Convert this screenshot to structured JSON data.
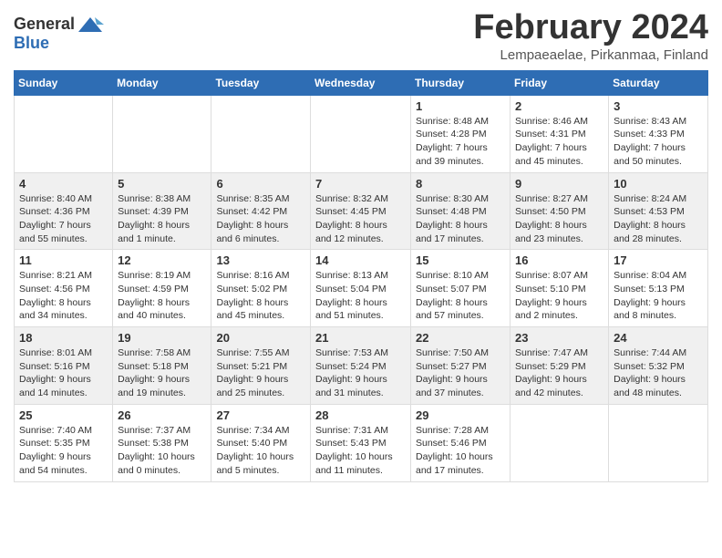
{
  "header": {
    "logo_general": "General",
    "logo_blue": "Blue",
    "month_title": "February 2024",
    "subtitle": "Lempaeaelae, Pirkanmaa, Finland"
  },
  "weekdays": [
    "Sunday",
    "Monday",
    "Tuesday",
    "Wednesday",
    "Thursday",
    "Friday",
    "Saturday"
  ],
  "weeks": [
    [
      {
        "day": "",
        "info": ""
      },
      {
        "day": "",
        "info": ""
      },
      {
        "day": "",
        "info": ""
      },
      {
        "day": "",
        "info": ""
      },
      {
        "day": "1",
        "info": "Sunrise: 8:48 AM\nSunset: 4:28 PM\nDaylight: 7 hours\nand 39 minutes."
      },
      {
        "day": "2",
        "info": "Sunrise: 8:46 AM\nSunset: 4:31 PM\nDaylight: 7 hours\nand 45 minutes."
      },
      {
        "day": "3",
        "info": "Sunrise: 8:43 AM\nSunset: 4:33 PM\nDaylight: 7 hours\nand 50 minutes."
      }
    ],
    [
      {
        "day": "4",
        "info": "Sunrise: 8:40 AM\nSunset: 4:36 PM\nDaylight: 7 hours\nand 55 minutes."
      },
      {
        "day": "5",
        "info": "Sunrise: 8:38 AM\nSunset: 4:39 PM\nDaylight: 8 hours\nand 1 minute."
      },
      {
        "day": "6",
        "info": "Sunrise: 8:35 AM\nSunset: 4:42 PM\nDaylight: 8 hours\nand 6 minutes."
      },
      {
        "day": "7",
        "info": "Sunrise: 8:32 AM\nSunset: 4:45 PM\nDaylight: 8 hours\nand 12 minutes."
      },
      {
        "day": "8",
        "info": "Sunrise: 8:30 AM\nSunset: 4:48 PM\nDaylight: 8 hours\nand 17 minutes."
      },
      {
        "day": "9",
        "info": "Sunrise: 8:27 AM\nSunset: 4:50 PM\nDaylight: 8 hours\nand 23 minutes."
      },
      {
        "day": "10",
        "info": "Sunrise: 8:24 AM\nSunset: 4:53 PM\nDaylight: 8 hours\nand 28 minutes."
      }
    ],
    [
      {
        "day": "11",
        "info": "Sunrise: 8:21 AM\nSunset: 4:56 PM\nDaylight: 8 hours\nand 34 minutes."
      },
      {
        "day": "12",
        "info": "Sunrise: 8:19 AM\nSunset: 4:59 PM\nDaylight: 8 hours\nand 40 minutes."
      },
      {
        "day": "13",
        "info": "Sunrise: 8:16 AM\nSunset: 5:02 PM\nDaylight: 8 hours\nand 45 minutes."
      },
      {
        "day": "14",
        "info": "Sunrise: 8:13 AM\nSunset: 5:04 PM\nDaylight: 8 hours\nand 51 minutes."
      },
      {
        "day": "15",
        "info": "Sunrise: 8:10 AM\nSunset: 5:07 PM\nDaylight: 8 hours\nand 57 minutes."
      },
      {
        "day": "16",
        "info": "Sunrise: 8:07 AM\nSunset: 5:10 PM\nDaylight: 9 hours\nand 2 minutes."
      },
      {
        "day": "17",
        "info": "Sunrise: 8:04 AM\nSunset: 5:13 PM\nDaylight: 9 hours\nand 8 minutes."
      }
    ],
    [
      {
        "day": "18",
        "info": "Sunrise: 8:01 AM\nSunset: 5:16 PM\nDaylight: 9 hours\nand 14 minutes."
      },
      {
        "day": "19",
        "info": "Sunrise: 7:58 AM\nSunset: 5:18 PM\nDaylight: 9 hours\nand 19 minutes."
      },
      {
        "day": "20",
        "info": "Sunrise: 7:55 AM\nSunset: 5:21 PM\nDaylight: 9 hours\nand 25 minutes."
      },
      {
        "day": "21",
        "info": "Sunrise: 7:53 AM\nSunset: 5:24 PM\nDaylight: 9 hours\nand 31 minutes."
      },
      {
        "day": "22",
        "info": "Sunrise: 7:50 AM\nSunset: 5:27 PM\nDaylight: 9 hours\nand 37 minutes."
      },
      {
        "day": "23",
        "info": "Sunrise: 7:47 AM\nSunset: 5:29 PM\nDaylight: 9 hours\nand 42 minutes."
      },
      {
        "day": "24",
        "info": "Sunrise: 7:44 AM\nSunset: 5:32 PM\nDaylight: 9 hours\nand 48 minutes."
      }
    ],
    [
      {
        "day": "25",
        "info": "Sunrise: 7:40 AM\nSunset: 5:35 PM\nDaylight: 9 hours\nand 54 minutes."
      },
      {
        "day": "26",
        "info": "Sunrise: 7:37 AM\nSunset: 5:38 PM\nDaylight: 10 hours\nand 0 minutes."
      },
      {
        "day": "27",
        "info": "Sunrise: 7:34 AM\nSunset: 5:40 PM\nDaylight: 10 hours\nand 5 minutes."
      },
      {
        "day": "28",
        "info": "Sunrise: 7:31 AM\nSunset: 5:43 PM\nDaylight: 10 hours\nand 11 minutes."
      },
      {
        "day": "29",
        "info": "Sunrise: 7:28 AM\nSunset: 5:46 PM\nDaylight: 10 hours\nand 17 minutes."
      },
      {
        "day": "",
        "info": ""
      },
      {
        "day": "",
        "info": ""
      }
    ]
  ]
}
